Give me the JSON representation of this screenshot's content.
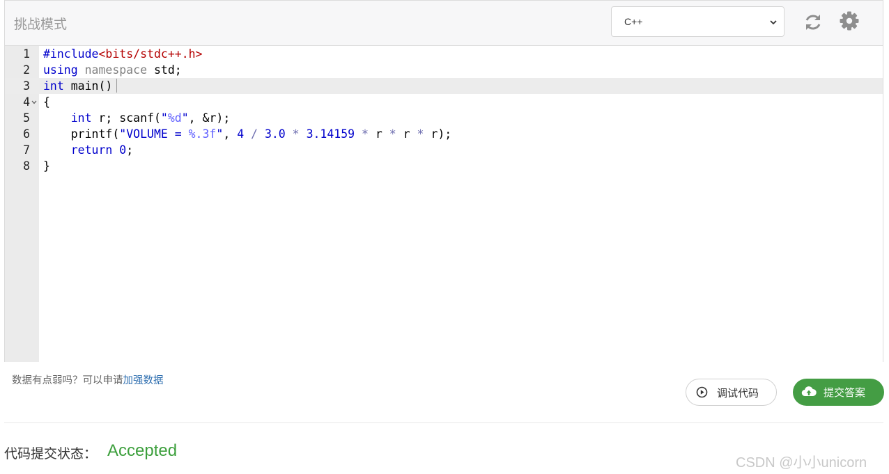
{
  "header": {
    "title": "挑战模式"
  },
  "language_select": {
    "value": "C++"
  },
  "icons": {
    "reset": "refresh-icon",
    "settings": "gear-icon",
    "debug": "play-circle-icon",
    "submit": "cloud-upload-icon"
  },
  "code": {
    "active_line": 3,
    "lines": [
      {
        "no": "1",
        "tokens": [
          {
            "t": "#include",
            "c": "pre"
          },
          {
            "t": "<bits/stdc++.h>",
            "c": "inc"
          }
        ]
      },
      {
        "no": "2",
        "tokens": [
          {
            "t": "using",
            "c": "kw"
          },
          {
            "t": " ",
            "c": "plain"
          },
          {
            "t": "namespace",
            "c": "dim"
          },
          {
            "t": " std;",
            "c": "plain"
          }
        ]
      },
      {
        "no": "3",
        "tokens": [
          {
            "t": "int",
            "c": "kw"
          },
          {
            "t": " main()",
            "c": "plain"
          }
        ]
      },
      {
        "no": "4",
        "fold": true,
        "tokens": [
          {
            "t": "{",
            "c": "plain"
          }
        ]
      },
      {
        "no": "5",
        "tokens": [
          {
            "t": "    ",
            "c": "plain"
          },
          {
            "t": "int",
            "c": "kw"
          },
          {
            "t": " r; scanf(",
            "c": "plain"
          },
          {
            "t": "\"",
            "c": "str"
          },
          {
            "t": "%d",
            "c": "fmt"
          },
          {
            "t": "\"",
            "c": "str"
          },
          {
            "t": ", &r);",
            "c": "plain"
          }
        ]
      },
      {
        "no": "6",
        "tokens": [
          {
            "t": "    printf(",
            "c": "plain"
          },
          {
            "t": "\"VOLUME = ",
            "c": "str"
          },
          {
            "t": "%.3f",
            "c": "fmt"
          },
          {
            "t": "\"",
            "c": "str"
          },
          {
            "t": ", ",
            "c": "plain"
          },
          {
            "t": "4",
            "c": "num"
          },
          {
            "t": " / ",
            "c": "op"
          },
          {
            "t": "3.0",
            "c": "num"
          },
          {
            "t": " * ",
            "c": "op"
          },
          {
            "t": "3.14159",
            "c": "num"
          },
          {
            "t": " * ",
            "c": "op"
          },
          {
            "t": "r",
            "c": "plain"
          },
          {
            "t": " * ",
            "c": "op"
          },
          {
            "t": "r",
            "c": "plain"
          },
          {
            "t": " * ",
            "c": "op"
          },
          {
            "t": "r);",
            "c": "plain"
          }
        ]
      },
      {
        "no": "7",
        "tokens": [
          {
            "t": "    ",
            "c": "plain"
          },
          {
            "t": "return",
            "c": "kw"
          },
          {
            "t": " ",
            "c": "plain"
          },
          {
            "t": "0",
            "c": "num"
          },
          {
            "t": ";",
            "c": "plain"
          }
        ]
      },
      {
        "no": "8",
        "tokens": [
          {
            "t": "}",
            "c": "plain"
          }
        ]
      }
    ]
  },
  "hint": {
    "text": "数据有点弱吗？可以申请",
    "link": "加强数据"
  },
  "buttons": {
    "debug": "调试代码",
    "submit": "提交答案"
  },
  "status": {
    "label": "代码提交状态：",
    "value": "Accepted"
  },
  "watermark": "CSDN @小小unicorn"
}
